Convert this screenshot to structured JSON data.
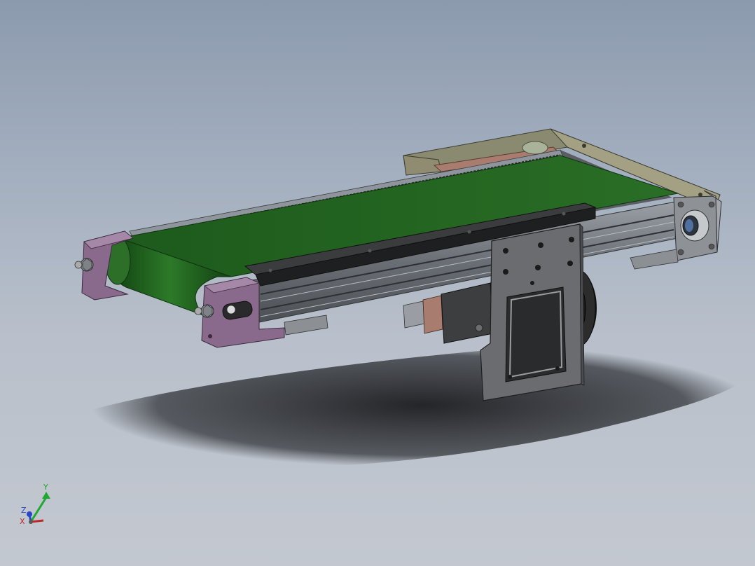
{
  "viewport": {
    "background_top": "#8c9aae",
    "background_bottom": "#c3c8d0"
  },
  "model": {
    "belt_color": "#1f5a1c",
    "frame_color": "#7a7f86",
    "end_cap_color": "#8a6a8c",
    "motor_color": "#2a2a2a",
    "mount_plate_color": "#6a6c70"
  },
  "triad": {
    "x_label": "X",
    "y_label": "Y",
    "z_label": "Z",
    "x_color": "#c0262a",
    "y_color": "#1fa832",
    "z_color": "#2a46c8"
  }
}
